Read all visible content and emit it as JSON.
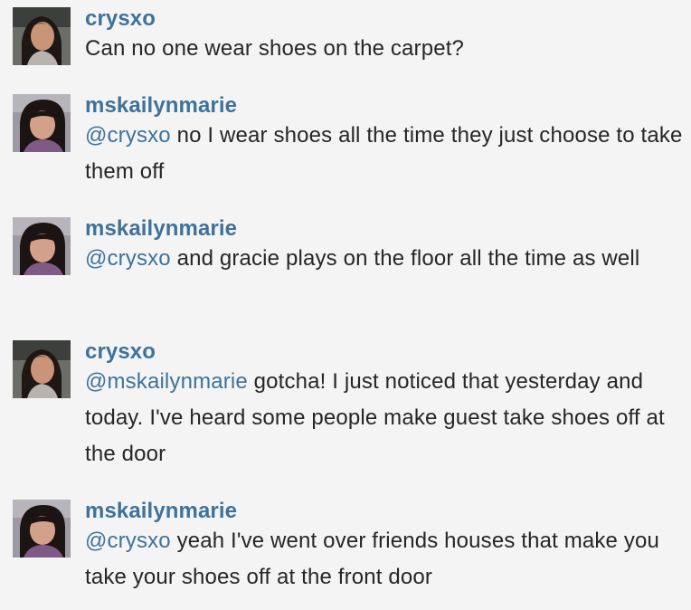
{
  "comments": [
    {
      "user": "crysxo",
      "avatar": "crysxo-avatar",
      "mention": "",
      "text": "Can no one wear shoes on the carpet?"
    },
    {
      "user": "mskailynmarie",
      "avatar": "mskailynmarie-avatar",
      "mention": "@crysxo",
      "text": " no I wear shoes all the time they just choose to take them off"
    },
    {
      "user": "mskailynmarie",
      "avatar": "mskailynmarie-avatar",
      "mention": "@crysxo",
      "text": " and gracie plays on the floor all the time as well"
    },
    {
      "user": "crysxo",
      "avatar": "crysxo-avatar",
      "mention": "@mskailynmarie",
      "text": " gotcha! I just noticed that yesterday and today. I've heard some people make guest take shoes off at the door"
    },
    {
      "user": "mskailynmarie",
      "avatar": "mskailynmarie-avatar",
      "mention": "@crysxo",
      "text": " yeah I've went over friends houses that make you take your shoes off at the front door"
    }
  ],
  "colors": {
    "link": "#3f729b",
    "text": "#262626",
    "background": "#f4f4f4"
  }
}
